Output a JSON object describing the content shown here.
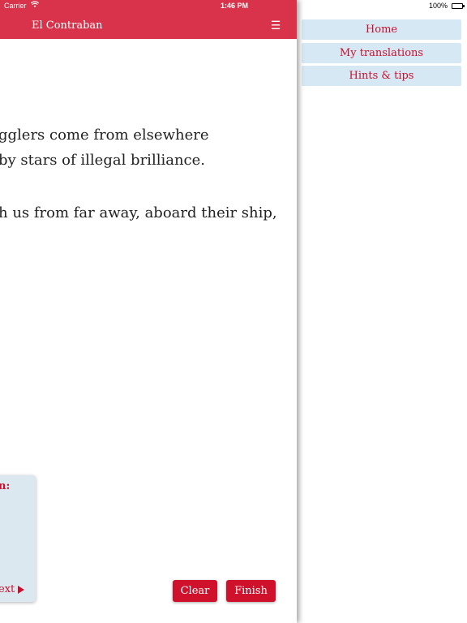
{
  "status_bar": {
    "carrier": "Carrier",
    "time": "1:46 PM",
    "battery": "100%"
  },
  "header": {
    "title": "El Contraban",
    "menu_icon": "☰"
  },
  "poem": {
    "lines": [
      "gglers  come from elsewhere",
      "by stars  of illegal brilliance.",
      "h us from far away,  aboard their ship,"
    ]
  },
  "hint_card": {
    "heading": "n:",
    "next_label": "ext"
  },
  "actions": {
    "clear_label": "Clear",
    "finish_label": "Finish"
  },
  "side_menu": {
    "items": [
      {
        "label": "Home"
      },
      {
        "label": "My translations"
      },
      {
        "label": "Hints & tips"
      }
    ]
  },
  "colors": {
    "header_red": "#d8334a",
    "button_red": "#d0112b",
    "menu_bg": "#d6e8f3",
    "hint_bg": "#dce8ef"
  }
}
